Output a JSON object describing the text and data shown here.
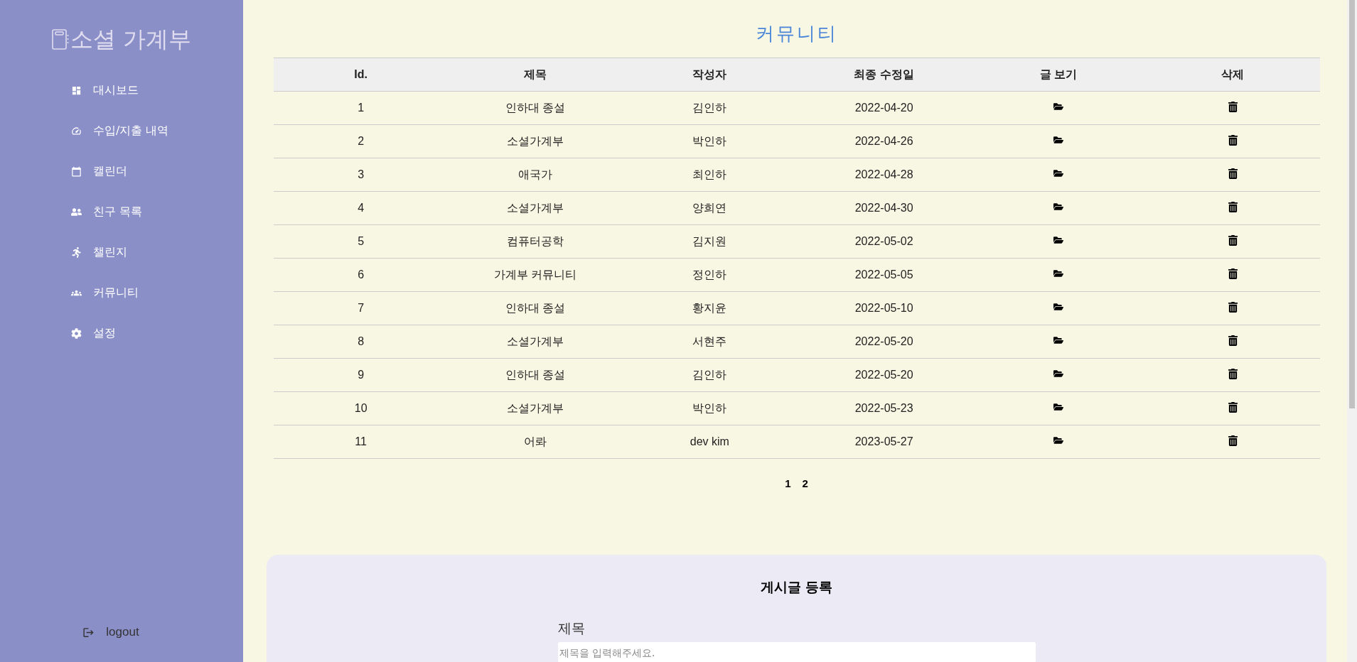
{
  "sidebar": {
    "logo": "소셜 가계부",
    "items": [
      {
        "label": "대시보드"
      },
      {
        "label": "수입/지출 내역"
      },
      {
        "label": "캘린더"
      },
      {
        "label": "친구 목록"
      },
      {
        "label": "챌린지"
      },
      {
        "label": "커뮤니티"
      },
      {
        "label": "설정"
      }
    ],
    "logout": "logout"
  },
  "page_title": "커뮤니티",
  "table": {
    "columns": [
      "Id.",
      "제목",
      "작성자",
      "최종 수정일",
      "글 보기",
      "삭제"
    ],
    "rows": [
      [
        "1",
        "인하대 종설",
        "김인하",
        "2022-04-20"
      ],
      [
        "2",
        "소셜가계부",
        "박인하",
        "2022-04-26"
      ],
      [
        "3",
        "애국가",
        "최인하",
        "2022-04-28"
      ],
      [
        "4",
        "소셜가계부",
        "양희연",
        "2022-04-30"
      ],
      [
        "5",
        "컴퓨터공학",
        "김지원",
        "2022-05-02"
      ],
      [
        "6",
        "가계부 커뮤니티",
        "정인하",
        "2022-05-05"
      ],
      [
        "7",
        "인하대 종설",
        "황지윤",
        "2022-05-10"
      ],
      [
        "8",
        "소셜가계부",
        "서현주",
        "2022-05-20"
      ],
      [
        "9",
        "인하대 종설",
        "김인하",
        "2022-05-20"
      ],
      [
        "10",
        "소셜가계부",
        "박인하",
        "2022-05-23"
      ],
      [
        "11",
        "어롸",
        "dev kim",
        "2023-05-27"
      ]
    ]
  },
  "pagination": [
    "1",
    "2"
  ],
  "form": {
    "title": "게시글 등록",
    "field_label": "제목",
    "placeholder": "제목을 입력해주세요."
  }
}
